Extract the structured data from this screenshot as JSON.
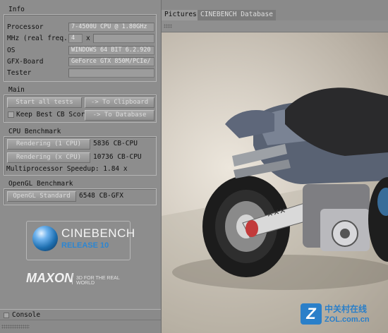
{
  "info": {
    "title": "Info",
    "processor_label": "Processor",
    "processor_value": "7-4500U CPU @ 1.80GHz",
    "mhz_label": "MHz (real freq.)",
    "mhz_value": "4",
    "mhz_x": "x",
    "os_label": "OS",
    "os_value": "WINDOWS 64 BIT 6.2.920",
    "gfx_label": "GFX-Board",
    "gfx_value": "GeForce GTX 850M/PCIe/",
    "tester_label": "Tester",
    "tester_value": ""
  },
  "main": {
    "title": "Main",
    "start_all": "Start all tests",
    "to_clipboard": "-> To Clipboard",
    "keep_best": "Keep Best CB Score",
    "to_database": "-> To Database"
  },
  "cpu": {
    "title": "CPU Benchmark",
    "render1_label": "Rendering (1 CPU)",
    "render1_value": "5836 CB-CPU",
    "renderx_label": "Rendering (x CPU)",
    "renderx_value": "10736 CB-CPU",
    "speedup": "Multiprocessor Speedup: 1.84 x"
  },
  "opengl": {
    "title": "OpenGL Benchmark",
    "standard_label": "OpenGL Standard",
    "standard_value": "6548 CB-GFX"
  },
  "branding": {
    "cinebench": "CINEBENCH",
    "release": "RELEASE 10",
    "maxon": "MAXON",
    "tagline": "3D FOR THE REAL WORLD"
  },
  "console": {
    "label": "Console"
  },
  "tabs": {
    "pictures": "Pictures",
    "database": "CINEBENCH Database"
  },
  "watermark": {
    "logo_letter": "Z",
    "cn": "中关村在线",
    "site": "ZOL.com.cn"
  },
  "colors": {
    "panel": "#8d8d8d",
    "cinebench_blue": "#1e6fb0",
    "watermark_blue": "#2a7fc9"
  }
}
